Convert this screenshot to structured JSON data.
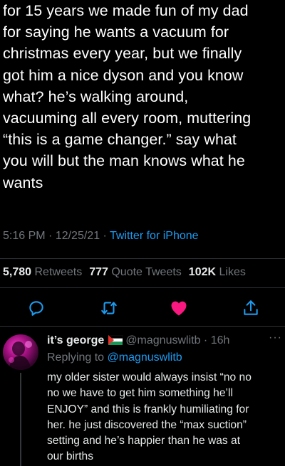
{
  "tweet": {
    "text": "for 15 years we made fun of my dad\nfor saying he wants a vacuum for\nchristmas every year, but we finally\ngot him a nice dyson and you know\nwhat? he’s walking around,\nvacuuming all every room, muttering\n“this is a game changer.” say what\nyou will but the man knows what he\nwants",
    "time": "5:16 PM",
    "sep1": " · ",
    "date": "12/25/21",
    "sep2": " · ",
    "source": "Twitter for iPhone"
  },
  "stats": {
    "retweets_count": "5,780",
    "retweets_label": "Retweets",
    "quotes_count": "777",
    "quotes_label": "Quote Tweets",
    "likes_count": "102K",
    "likes_label": "Likes"
  },
  "actions": {
    "icons": [
      "reply-icon",
      "retweet-icon",
      "like-icon",
      "share-icon"
    ],
    "like_color": "#f91880",
    "icon_color": "#1d9bf0"
  },
  "reply": {
    "name": "it’s george",
    "handle": "@magnuswlitb",
    "dot": " · ",
    "time": "16h",
    "more": "···",
    "replying_prefix": "Replying to",
    "replying_handle": "@magnuswlitb",
    "text": "my older sister would always insist “no no\nno we have to get him something he’ll\nENJOY” and this is frankly humiliating for\nher. he just discovered the “max suction”\nsetting and he’s happier than he was at\nour births"
  },
  "colors": {
    "background": "#000000",
    "text": "#e7e9ea",
    "muted": "#71767b",
    "link": "#1d9bf0",
    "divider": "#2f3336"
  }
}
